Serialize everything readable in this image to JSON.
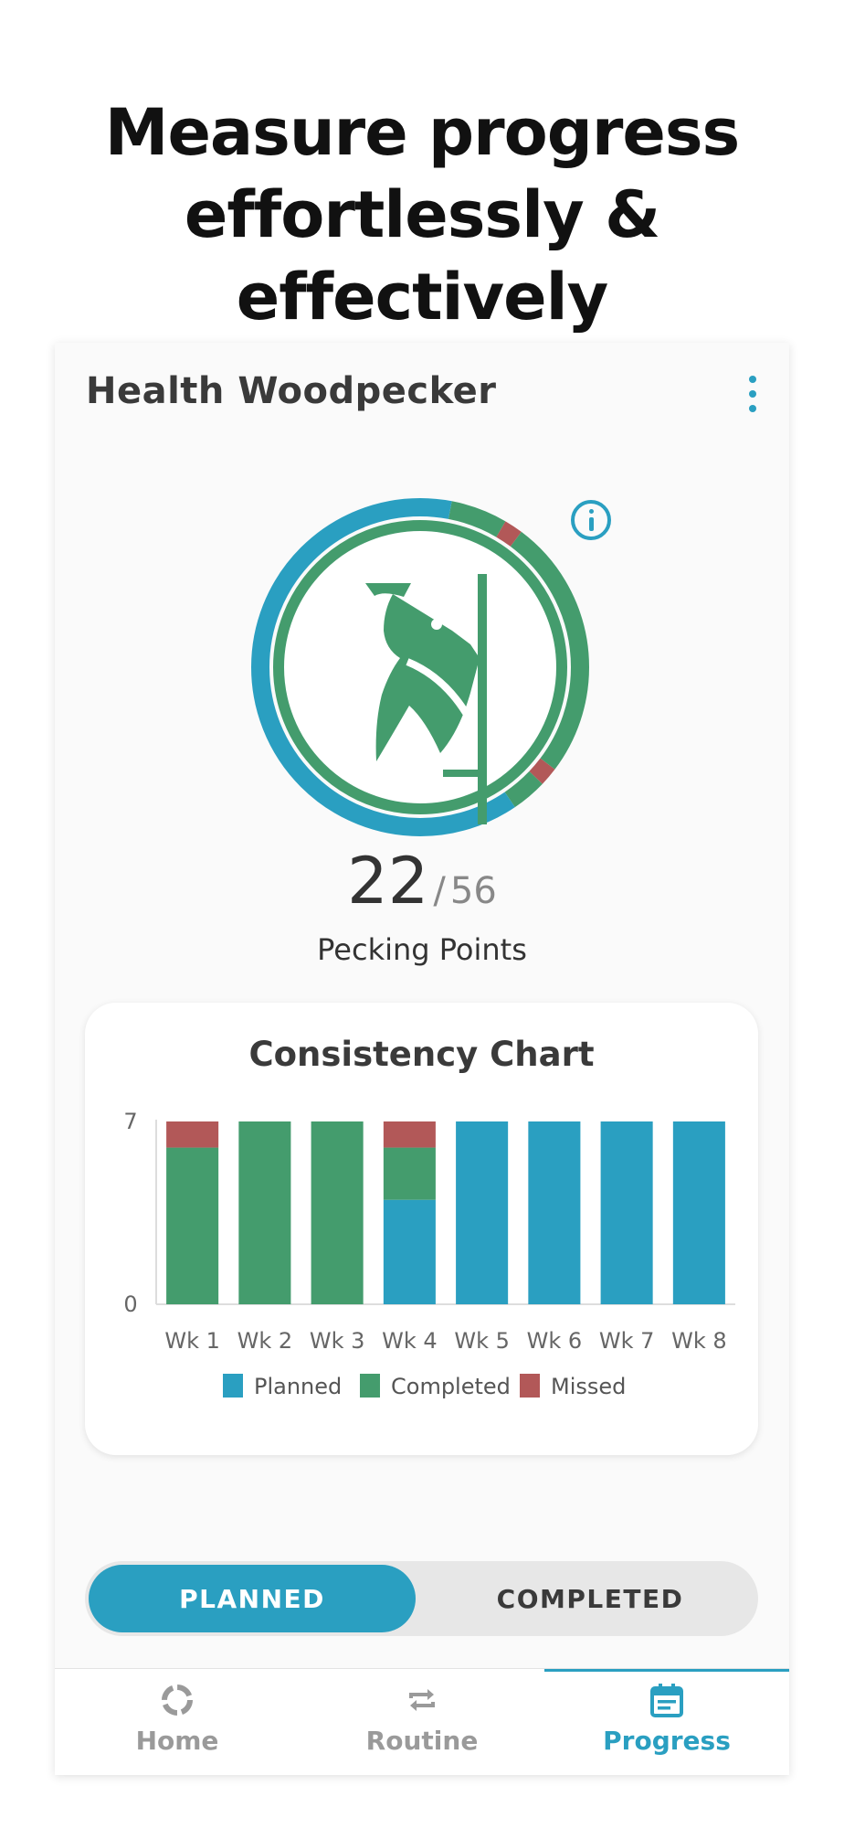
{
  "headline": {
    "line1": "Measure progress",
    "line2": "effortlessly & effectively"
  },
  "app": {
    "title": "Health Woodpecker",
    "menu_icon": "more-vertical-icon",
    "info_icon": "info-icon",
    "logo_icon": "woodpecker-logo-icon"
  },
  "progress_ring": {
    "earned": 22,
    "total": 56,
    "separator": "/",
    "label": "Pecking Points",
    "planned_fraction": 0.625,
    "completed_fraction": 0.339,
    "missed_fraction": 0.036
  },
  "colors": {
    "planned": "#2a9fc1",
    "completed": "#449c6d",
    "missed": "#b25858",
    "accent": "#2a9fc1",
    "nav_inactive": "#9a9a9a"
  },
  "chart_data": {
    "type": "bar",
    "stacked": true,
    "title": "Consistency Chart",
    "categories": [
      "Wk 1",
      "Wk 2",
      "Wk 3",
      "Wk 4",
      "Wk 5",
      "Wk 6",
      "Wk 7",
      "Wk 8"
    ],
    "series": [
      {
        "name": "Planned",
        "color": "#2a9fc1",
        "values": [
          0,
          0,
          0,
          4,
          7,
          7,
          7,
          7
        ]
      },
      {
        "name": "Completed",
        "color": "#449c6d",
        "values": [
          6,
          7,
          7,
          2,
          0,
          0,
          0,
          0
        ]
      },
      {
        "name": "Missed",
        "color": "#b25858",
        "values": [
          1,
          0,
          0,
          1,
          0,
          0,
          0,
          0
        ]
      }
    ],
    "ylim": [
      0,
      7
    ],
    "yticks": [
      "0",
      "7"
    ],
    "legend_position": "bottom",
    "grid": false
  },
  "toggle": {
    "planned_label": "PLANNED",
    "completed_label": "COMPLETED",
    "active": "planned"
  },
  "nav": {
    "items": [
      {
        "label": "Home",
        "icon": "home-ring-icon",
        "active": false
      },
      {
        "label": "Routine",
        "icon": "repeat-icon",
        "active": false
      },
      {
        "label": "Progress",
        "icon": "calendar-icon",
        "active": true
      }
    ]
  }
}
